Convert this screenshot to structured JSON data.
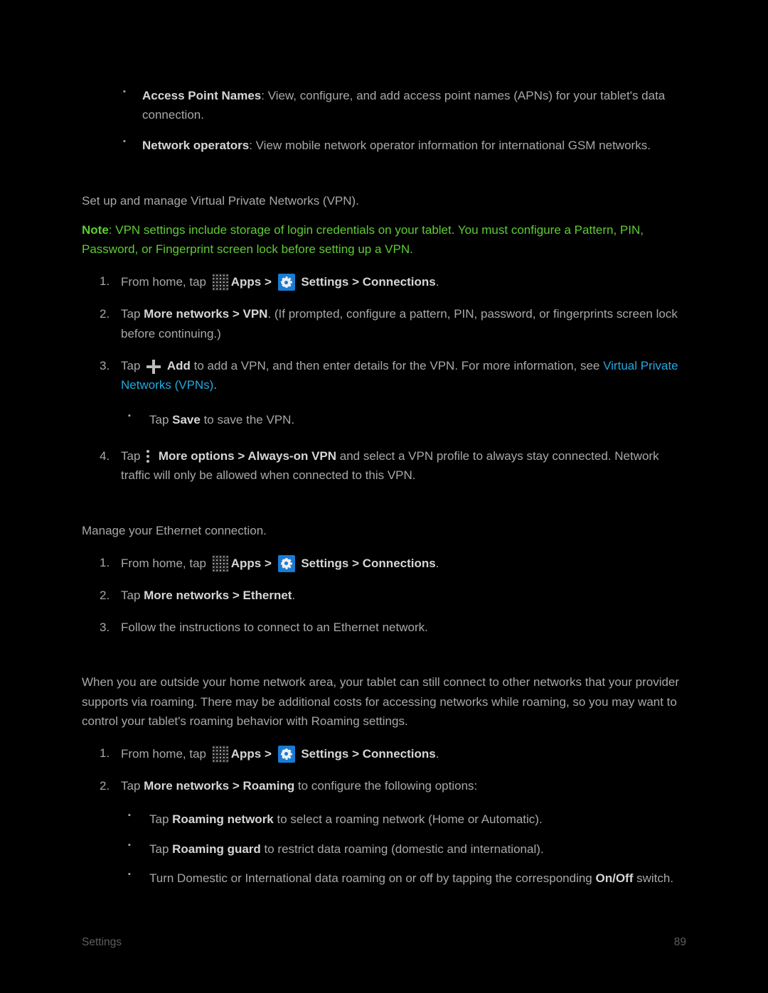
{
  "top_bullets": [
    {
      "label": "Access Point Names",
      "text": ": View, configure, and add access point names (APNs) for your tablet's data connection."
    },
    {
      "label": "Network operators",
      "text": ": View mobile network operator information for international GSM networks."
    }
  ],
  "vpn": {
    "intro": "Set up and manage Virtual Private Networks (VPN).",
    "note_label": "Note",
    "note_text": ": VPN settings include storage of login credentials on your tablet. You must configure a Pattern, PIN, Password, or Fingerprint screen lock before setting up a VPN.",
    "steps": {
      "s1": {
        "num": "1.",
        "pre": "From home, tap ",
        "apps": "Apps > ",
        "settings": "Settings > Connections",
        "post": "."
      },
      "s2": {
        "num": "2.",
        "pre": "Tap ",
        "b": "More networks > VPN",
        "post": ". (If prompted, configure a pattern, PIN, password, or fingerprints screen lock before continuing.)"
      },
      "s3": {
        "num": "3.",
        "pre": "Tap ",
        "b": "Add",
        "mid": " to add a VPN, and then enter details for the VPN. For more information, see ",
        "link": "Virtual Private Networks (VPNs)",
        "post": ".",
        "sub": {
          "pre": "Tap ",
          "b": "Save",
          "post": " to save the VPN."
        }
      },
      "s4": {
        "num": "4.",
        "pre": "Tap ",
        "b": "More options > Always-on VPN",
        "post": " and select a VPN profile to always stay connected. Network traffic will only be allowed when connected to this VPN."
      }
    }
  },
  "ethernet": {
    "intro": "Manage your Ethernet connection.",
    "steps": {
      "s1": {
        "num": "1.",
        "pre": "From home, tap ",
        "apps": "Apps > ",
        "settings": "Settings > Connections",
        "post": "."
      },
      "s2": {
        "num": "2.",
        "pre": "Tap ",
        "b": "More networks > Ethernet",
        "post": "."
      },
      "s3": {
        "num": "3.",
        "text": "Follow the instructions to connect to an Ethernet network."
      }
    }
  },
  "roaming": {
    "intro": "When you are outside your home network area, your tablet can still connect to other networks that your provider supports via roaming. There may be additional costs for accessing networks while roaming, so you may want to control your tablet's roaming behavior with Roaming settings.",
    "steps": {
      "s1": {
        "num": "1.",
        "pre": "From home, tap ",
        "apps": "Apps > ",
        "settings": "Settings > Connections",
        "post": "."
      },
      "s2": {
        "num": "2.",
        "pre": "Tap ",
        "b": "More networks > Roaming",
        "post": " to configure the following options:"
      }
    },
    "sub": {
      "a": {
        "pre": "Tap ",
        "b": "Roaming network",
        "post": " to select a roaming network (Home or Automatic)."
      },
      "b": {
        "pre": "Tap ",
        "b": "Roaming guard",
        "post": " to restrict data roaming (domestic and international)."
      },
      "c": {
        "pre": "Turn Domestic or International data roaming on or off by tapping the corresponding ",
        "b": "On/Off",
        "post": " switch."
      }
    }
  },
  "footer": {
    "left": "Settings",
    "right": "89"
  }
}
